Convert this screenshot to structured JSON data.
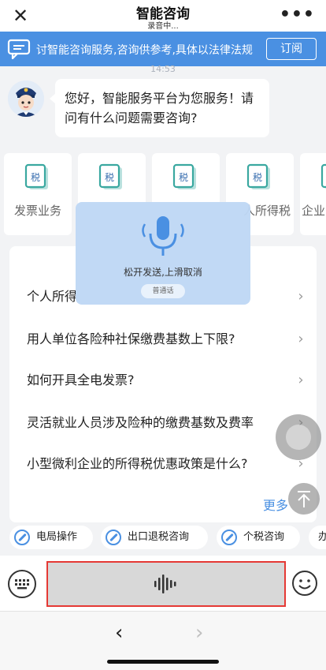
{
  "header": {
    "title": "智能咨询",
    "subtitle": "录音中...",
    "close_glyph": "✕",
    "more_glyph": "•••"
  },
  "notice": {
    "text": "讨智能咨询服务,咨询供参考,具体以法律法规",
    "subscribe_label": "订阅"
  },
  "chat": {
    "time": "14:53",
    "greeting": "您好，智能服务平台为您服务！请问有什么问题需要咨询?"
  },
  "categories": [
    {
      "label": "发票业务"
    },
    {
      "label": ""
    },
    {
      "label": ""
    },
    {
      "label": "人所得税"
    },
    {
      "label": "企业"
    }
  ],
  "tax_icon_text": "税",
  "voice_popup": {
    "prompt": "松开发送,上滑取消",
    "language": "普通话"
  },
  "questions": [
    {
      "text": "个人所得"
    },
    {
      "text": "用人单位各险种社保缴费基数上下限?"
    },
    {
      "text": "如何开具全电发票?"
    },
    {
      "text": "灵活就业人员涉及险种的缴费基数及费率"
    },
    {
      "text": "小型微利企业的所得税优惠政策是什么?"
    }
  ],
  "more_label": "更多",
  "quick_chips": [
    {
      "label": "电局操作"
    },
    {
      "label": "出口退税咨询"
    },
    {
      "label": "个税咨询"
    },
    {
      "label": "办"
    }
  ],
  "nav": {
    "back_glyph": "‹",
    "forward_glyph": "›"
  },
  "colors": {
    "accent": "#4a90e2",
    "highlight_border": "#e53935"
  }
}
